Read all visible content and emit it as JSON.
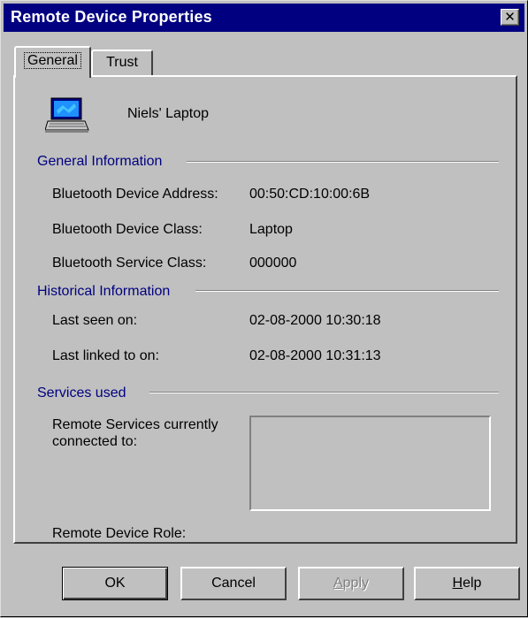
{
  "window": {
    "title": "Remote Device Properties",
    "close_glyph": "✕"
  },
  "tabs": [
    {
      "label": "General",
      "selected": true
    },
    {
      "label": "Trust",
      "selected": false
    }
  ],
  "device": {
    "icon": "laptop-icon",
    "name": "Niels' Laptop"
  },
  "general_info": {
    "heading": "General Information",
    "address_label": "Bluetooth Device Address:",
    "address_value": "00:50:CD:10:00:6B",
    "class_label": "Bluetooth Device Class:",
    "class_value": "Laptop",
    "service_label": "Bluetooth Service Class:",
    "service_value": "000000"
  },
  "historical_info": {
    "heading": "Historical Information",
    "last_seen_label": "Last seen on:",
    "last_seen_value": "02-08-2000 10:30:18",
    "last_linked_label": "Last linked to on:",
    "last_linked_value": "02-08-2000 10:31:13"
  },
  "services": {
    "heading": "Services used",
    "connected_label_line1": "Remote Services currently",
    "connected_label_line2": "connected to:",
    "role_label": "Remote Device Role:"
  },
  "buttons": {
    "ok": "OK",
    "cancel": "Cancel",
    "apply_first": "A",
    "apply_rest": "pply",
    "help_first": "H",
    "help_rest": "elp"
  },
  "colors": {
    "title_bar": "#000080",
    "section_heading": "#000080",
    "face": "#c0c0c0"
  }
}
